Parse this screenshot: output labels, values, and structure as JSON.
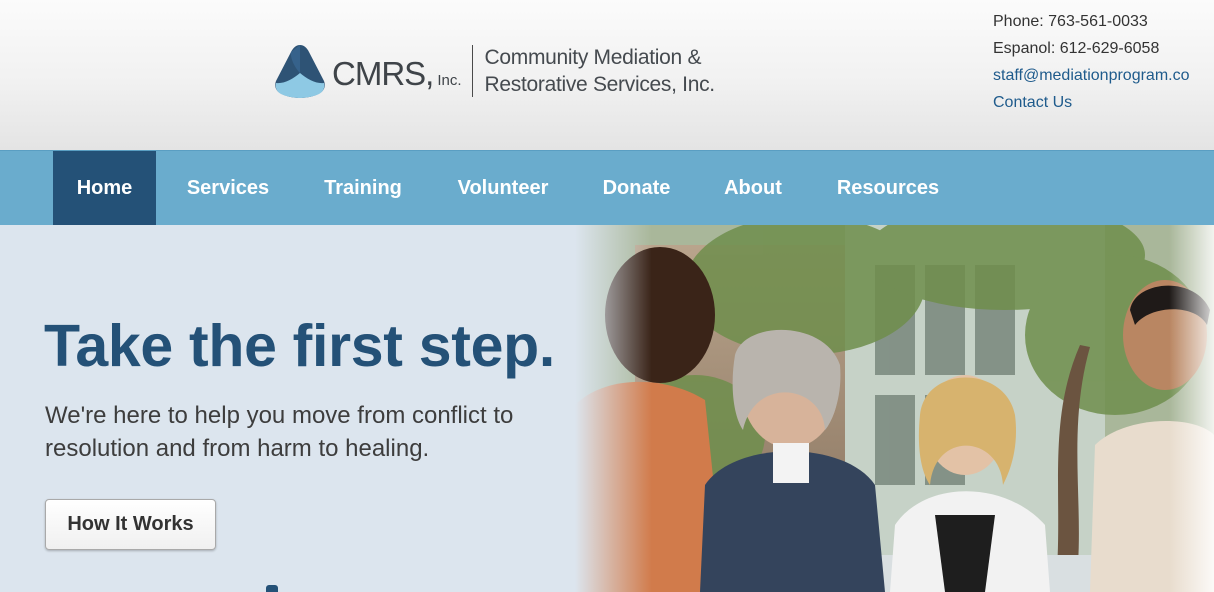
{
  "brand": {
    "abbr": "CMRS,",
    "inc": "Inc.",
    "name_line1": "Community Mediation &",
    "name_line2": "Restorative Services, Inc.",
    "logo_icon": "triangle-mark-icon",
    "colors": {
      "mark_dark": "#2e5375",
      "mark_light": "#8ec9e4"
    }
  },
  "contact": {
    "phone": "Phone: 763-561-0033",
    "espanol": "Espanol: 612-629-6058",
    "email": "staff@mediationprogram.co",
    "contact_link": "Contact Us"
  },
  "nav": {
    "items": [
      {
        "label": "Home",
        "active": true
      },
      {
        "label": "Services",
        "active": false
      },
      {
        "label": "Training",
        "active": false
      },
      {
        "label": "Volunteer",
        "active": false
      },
      {
        "label": "Donate",
        "active": false
      },
      {
        "label": "About",
        "active": false
      },
      {
        "label": "Resources",
        "active": false
      }
    ],
    "colors": {
      "bar": "#6aaccd",
      "active": "#245177",
      "text": "#ffffff"
    }
  },
  "hero": {
    "headline": "Take the first step.",
    "subtext": "We're here to help you move from conflict to resolution and from harm to healing.",
    "cta_label": "How It Works",
    "image_subject": "four people talking at an outdoor table",
    "colors": {
      "headline": "#245177",
      "background": "#dce5ee"
    }
  }
}
